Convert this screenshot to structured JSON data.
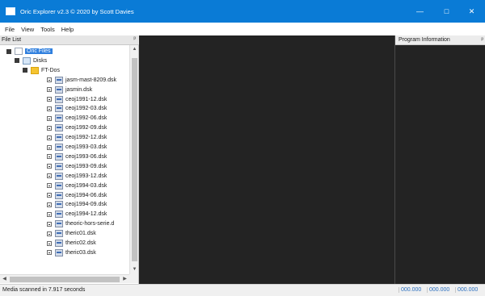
{
  "window": {
    "title": "Oric Explorer v2.3 © 2020 by Scott Davies",
    "minimize_label": "—",
    "maximize_label": "□",
    "close_label": "✕"
  },
  "menu": [
    "File",
    "View",
    "Tools",
    "Help"
  ],
  "file_list": {
    "header": "File List",
    "pin_glyph": "ᵖ",
    "tree": [
      {
        "label": "Oric Files",
        "level": 0,
        "icon": "root-icon",
        "toggle": "minus",
        "selected": true
      },
      {
        "label": "Disks",
        "level": 1,
        "icon": "disks-icon",
        "toggle": "minus"
      },
      {
        "label": "FT-Dos",
        "level": 2,
        "icon": "folder-icon",
        "toggle": "minus"
      },
      {
        "label": "jasm-mast-8209.dsk",
        "level": 3,
        "icon": "disk-icon",
        "toggle": "plus"
      },
      {
        "label": "jasmin.dsk",
        "level": 3,
        "icon": "disk-icon",
        "toggle": "plus"
      },
      {
        "label": "ceoj1991-12.dsk",
        "level": 3,
        "icon": "disk-icon",
        "toggle": "plus"
      },
      {
        "label": "ceoj1992-03.dsk",
        "level": 3,
        "icon": "disk-icon",
        "toggle": "plus"
      },
      {
        "label": "ceoj1992-06.dsk",
        "level": 3,
        "icon": "disk-icon",
        "toggle": "plus"
      },
      {
        "label": "ceoj1992-09.dsk",
        "level": 3,
        "icon": "disk-icon",
        "toggle": "plus"
      },
      {
        "label": "ceoj1992-12.dsk",
        "level": 3,
        "icon": "disk-icon",
        "toggle": "plus"
      },
      {
        "label": "ceoj1993-03.dsk",
        "level": 3,
        "icon": "disk-icon",
        "toggle": "plus"
      },
      {
        "label": "ceoj1993-06.dsk",
        "level": 3,
        "icon": "disk-icon",
        "toggle": "plus"
      },
      {
        "label": "ceoj1993-09.dsk",
        "level": 3,
        "icon": "disk-icon",
        "toggle": "plus"
      },
      {
        "label": "ceoj1993-12.dsk",
        "level": 3,
        "icon": "disk-icon",
        "toggle": "plus"
      },
      {
        "label": "ceoj1994-03.dsk",
        "level": 3,
        "icon": "disk-icon",
        "toggle": "plus"
      },
      {
        "label": "ceoj1994-06.dsk",
        "level": 3,
        "icon": "disk-icon",
        "toggle": "plus"
      },
      {
        "label": "ceoj1994-09.dsk",
        "level": 3,
        "icon": "disk-icon",
        "toggle": "plus"
      },
      {
        "label": "ceoj1994-12.dsk",
        "level": 3,
        "icon": "disk-icon",
        "toggle": "plus"
      },
      {
        "label": "theoric-hors-serie.d",
        "level": 3,
        "icon": "disk-icon",
        "toggle": "plus"
      },
      {
        "label": "theric01.dsk",
        "level": 3,
        "icon": "disk-icon",
        "toggle": "plus"
      },
      {
        "label": "theric02.dsk",
        "level": 3,
        "icon": "disk-icon",
        "toggle": "plus"
      },
      {
        "label": "theric03.dsk",
        "level": 3,
        "icon": "disk-icon",
        "toggle": "plus"
      }
    ]
  },
  "program_info": {
    "header": "Program Information",
    "extra": "ᵖ"
  },
  "status": {
    "message": "Media scanned in 7.917 seconds",
    "fields": [
      "000.000",
      "000.000",
      "000.000"
    ]
  },
  "colors": {
    "titlebar": "#0a7bd6",
    "panel_dark": "#232323",
    "selection": "#2f7fde",
    "status_text_blue": "#2a6fbf"
  }
}
